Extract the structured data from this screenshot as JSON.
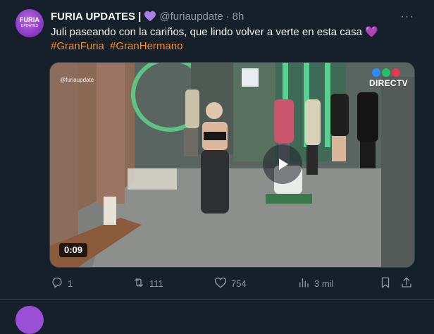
{
  "tweet": {
    "author_name": "FURIA UPDATES |",
    "handle": "@furiaupdate",
    "separator": "·",
    "time": "8h",
    "more": "···",
    "avatar_text": "FURIA",
    "avatar_subtext": "UPDATES",
    "text": "Juli paseando con la cariños, que lindo volver a verte en esta casa 💜",
    "hashtags": [
      "#GranFuria",
      "#GranHermano"
    ],
    "colors": {
      "hashtag": "#ff8c1a",
      "heart": "#a97ee8",
      "background": "#15202b",
      "muted": "#8b98a5"
    }
  },
  "media": {
    "watermark": "@furiaupdate",
    "brand": "DIRECTV",
    "duration": "0:09",
    "play_icon": "play-icon"
  },
  "actions": {
    "replies": "1",
    "reposts": "111",
    "likes": "754",
    "views": "3 mil",
    "icons": [
      "reply-icon",
      "repost-icon",
      "like-icon",
      "views-icon",
      "bookmark-icon",
      "share-icon"
    ]
  }
}
